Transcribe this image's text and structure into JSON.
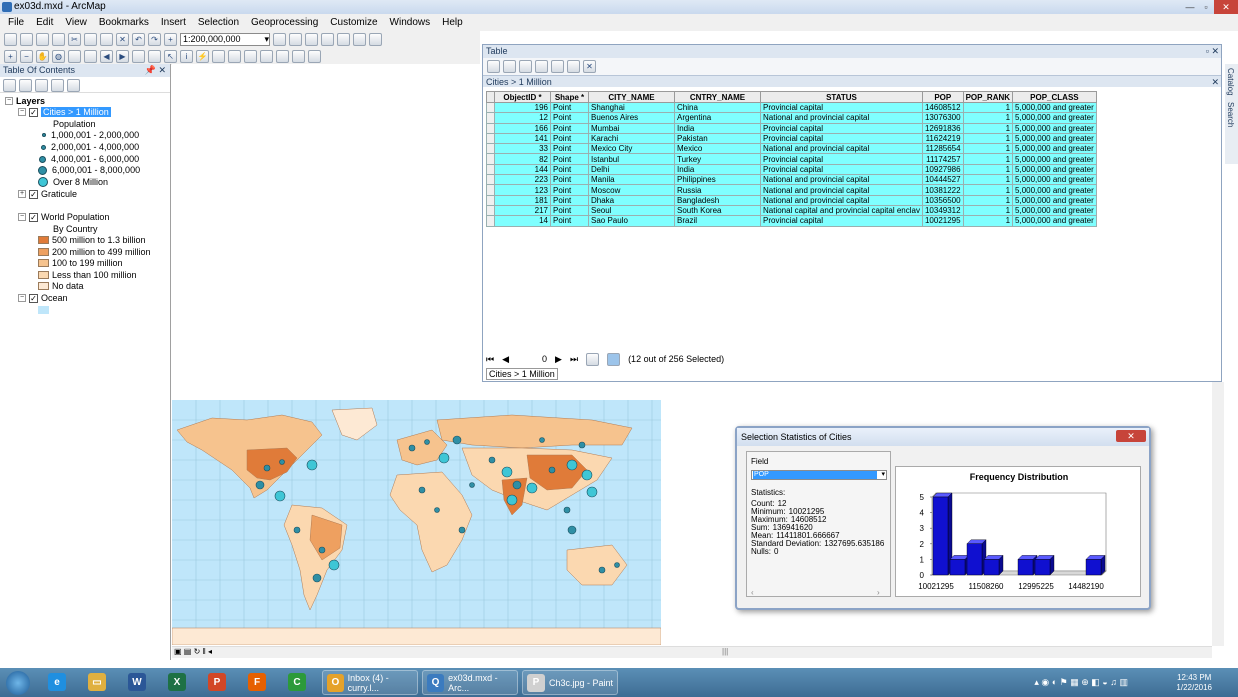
{
  "window": {
    "title": "ex03d.mxd - ArcMap"
  },
  "menu": [
    "File",
    "Edit",
    "View",
    "Bookmarks",
    "Insert",
    "Selection",
    "Geoprocessing",
    "Customize",
    "Windows",
    "Help"
  ],
  "toolbar": {
    "scale": "1:200,000,000"
  },
  "toc": {
    "title": "Table Of Contents",
    "layers_label": "Layers",
    "cities_layer": "Cities > 1 Million",
    "population_label": "Population",
    "population_classes": [
      "1,000,001 - 2,000,000",
      "2,000,001 - 4,000,000",
      "4,000,001 - 6,000,000",
      "6,000,001 - 8,000,000",
      "Over 8 Million"
    ],
    "graticule": "Graticule",
    "world_population": "World Population",
    "by_country": "By Country",
    "country_classes": [
      "500 million to 1.3 billion",
      "200 million to 499 million",
      "100 to 199 million",
      "Less than 100 million",
      "No data"
    ],
    "ocean": "Ocean"
  },
  "colors": {
    "country_classes": [
      "#e07b39",
      "#eea060",
      "#f6c38e",
      "#fbd8b0",
      "#fde9d4"
    ],
    "ocean": "#bfe6fa",
    "selected_row": "#7fffff"
  },
  "table": {
    "window_title": "Table",
    "tab_title": "Cities > 1 Million",
    "columns": [
      "ObjectID *",
      "Shape *",
      "CITY_NAME",
      "CNTRY_NAME",
      "STATUS",
      "POP",
      "POP_RANK",
      "POP_CLASS"
    ],
    "rows": [
      [
        "196",
        "Point",
        "Shanghai",
        "China",
        "Provincial capital",
        "14608512",
        "1",
        "5,000,000 and greater"
      ],
      [
        "12",
        "Point",
        "Buenos Aires",
        "Argentina",
        "National and provincial capital",
        "13076300",
        "1",
        "5,000,000 and greater"
      ],
      [
        "166",
        "Point",
        "Mumbai",
        "India",
        "Provincial capital",
        "12691836",
        "1",
        "5,000,000 and greater"
      ],
      [
        "141",
        "Point",
        "Karachi",
        "Pakistan",
        "Provincial capital",
        "11624219",
        "1",
        "5,000,000 and greater"
      ],
      [
        "33",
        "Point",
        "Mexico City",
        "Mexico",
        "National and provincial capital",
        "11285654",
        "1",
        "5,000,000 and greater"
      ],
      [
        "82",
        "Point",
        "Istanbul",
        "Turkey",
        "Provincial capital",
        "11174257",
        "1",
        "5,000,000 and greater"
      ],
      [
        "144",
        "Point",
        "Delhi",
        "India",
        "Provincial capital",
        "10927986",
        "1",
        "5,000,000 and greater"
      ],
      [
        "223",
        "Point",
        "Manila",
        "Philippines",
        "National and provincial capital",
        "10444527",
        "1",
        "5,000,000 and greater"
      ],
      [
        "123",
        "Point",
        "Moscow",
        "Russia",
        "National and provincial capital",
        "10381222",
        "1",
        "5,000,000 and greater"
      ],
      [
        "181",
        "Point",
        "Dhaka",
        "Bangladesh",
        "National and provincial capital",
        "10356500",
        "1",
        "5,000,000 and greater"
      ],
      [
        "217",
        "Point",
        "Seoul",
        "South Korea",
        "National capital and provincial capital enclav",
        "10349312",
        "1",
        "5,000,000 and greater"
      ],
      [
        "14",
        "Point",
        "Sao Paulo",
        "Brazil",
        "Provincial capital",
        "10021295",
        "1",
        "5,000,000 and greater"
      ]
    ],
    "record_index": "0",
    "selection_status": "(12 out of 256 Selected)",
    "bottom_tab": "Cities > 1 Million"
  },
  "right_dock": [
    "Catalog",
    "Search"
  ],
  "stats": {
    "title": "Selection Statistics of Cities",
    "field_label": "Field",
    "field_value": "POP",
    "statistics_label": "Statistics:",
    "lines": [
      {
        "label": "Count:",
        "value": "12"
      },
      {
        "label": "Minimum:",
        "value": "10021295"
      },
      {
        "label": "Maximum:",
        "value": "14608512"
      },
      {
        "label": "Sum:",
        "value": "136941620"
      },
      {
        "label": "Mean:",
        "value": "11411801.666667"
      },
      {
        "label": "Standard Deviation:",
        "value": "1327695.635186"
      },
      {
        "label": "Nulls:",
        "value": "0"
      }
    ]
  },
  "chart_data": {
    "type": "bar",
    "title": "Frequency Distribution",
    "x_tick_labels": [
      "10021295",
      "11508260",
      "12995225",
      "14482190"
    ],
    "y_tick_labels": [
      "0",
      "1",
      "2",
      "3",
      "4",
      "5"
    ],
    "ylim": [
      0,
      5
    ],
    "values": [
      5,
      1,
      2,
      1,
      0,
      1,
      1,
      0,
      0,
      1
    ],
    "bar_color": "#1010d0"
  },
  "taskbar": {
    "items": [
      {
        "label": "Inbox (4) - curry.l...",
        "color": "#e5a22a",
        "glyph": "O"
      },
      {
        "label": "ex03d.mxd - Arc...",
        "color": "#3b7bbf",
        "glyph": "Q"
      },
      {
        "label": "Ch3c.jpg - Paint",
        "color": "#d0d0d0",
        "glyph": "P"
      }
    ],
    "pinned": [
      {
        "glyph": "e",
        "color": "#1f8fe0"
      },
      {
        "glyph": "▭",
        "color": "#e0b040"
      },
      {
        "glyph": "W",
        "color": "#2b5797"
      },
      {
        "glyph": "X",
        "color": "#1e7145"
      },
      {
        "glyph": "P",
        "color": "#d24726"
      },
      {
        "glyph": "F",
        "color": "#e66000"
      },
      {
        "glyph": "C",
        "color": "#2c9a3a"
      }
    ],
    "time": "12:43 PM",
    "date": "1/22/2016"
  }
}
